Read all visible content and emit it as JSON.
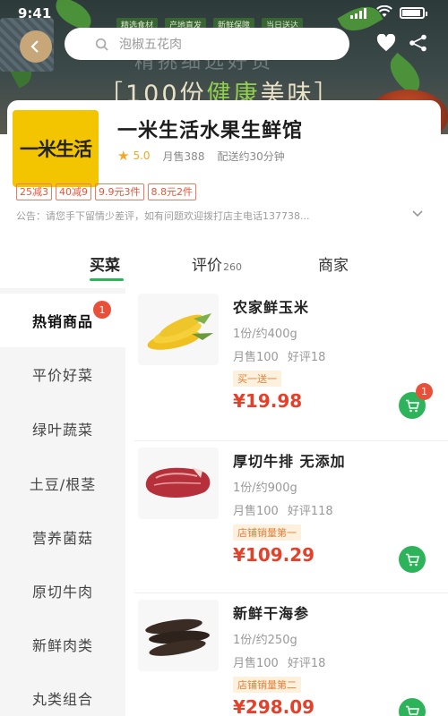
{
  "status_bar": {
    "time": "9:41"
  },
  "hero": {
    "banner_text_prefix": "［100份",
    "banner_text_highlight": "健康",
    "banner_text_suffix": "美味］",
    "banner_ghost_text": "精挑细选好货",
    "banner_chips": [
      "精选食材",
      "产地直发",
      "新鲜保障",
      "当日送达"
    ]
  },
  "search": {
    "placeholder": "泡椒五花肉"
  },
  "store": {
    "logo_text": "一米生活",
    "name": "一米生活水果生鲜馆",
    "rating": "5.0",
    "monthly_sales": "月售388",
    "delivery": "配送约30分钟",
    "coupons": [
      "25减3",
      "40减9",
      "9.9元3件",
      "8.8元2件"
    ],
    "notice": "公告：请您手下留情少差评，如有问题欢迎拨打店主电话137738..."
  },
  "tabs": [
    {
      "label": "买菜",
      "count": ""
    },
    {
      "label": "评价",
      "count": "260"
    },
    {
      "label": "商家",
      "count": ""
    }
  ],
  "categories": [
    {
      "label": "热销商品",
      "badge": "1"
    },
    {
      "label": "平价好菜"
    },
    {
      "label": "绿叶蔬菜"
    },
    {
      "label": "土豆/根茎"
    },
    {
      "label": "营养菌菇"
    },
    {
      "label": "原切牛肉"
    },
    {
      "label": "新鲜肉类"
    },
    {
      "label": "丸类组合"
    }
  ],
  "products": [
    {
      "name": "农家鲜玉米",
      "spec": "1份/约400g",
      "sales": "月售100",
      "reviews": "好评18",
      "tag": "买一送一",
      "price": "¥19.98",
      "cart_count": "1",
      "image": "corn"
    },
    {
      "name": "厚切牛排 无添加",
      "spec": "1份/约900g",
      "sales": "月售100",
      "reviews": "好评118",
      "tag": "店铺销量第一",
      "price": "¥109.29",
      "cart_count": "",
      "image": "steak"
    },
    {
      "name": "新鲜干海参",
      "spec": "1份/约250g",
      "sales": "月售100",
      "reviews": "好评18",
      "tag": "店铺销量第二",
      "price": "¥298.09",
      "cart_count": "",
      "image": "sea-cucumber"
    }
  ],
  "colors": {
    "accent_green": "#2db45a",
    "price_red": "#e5402a",
    "logo_yellow": "#f3c400",
    "badge_red": "#e8503a"
  }
}
